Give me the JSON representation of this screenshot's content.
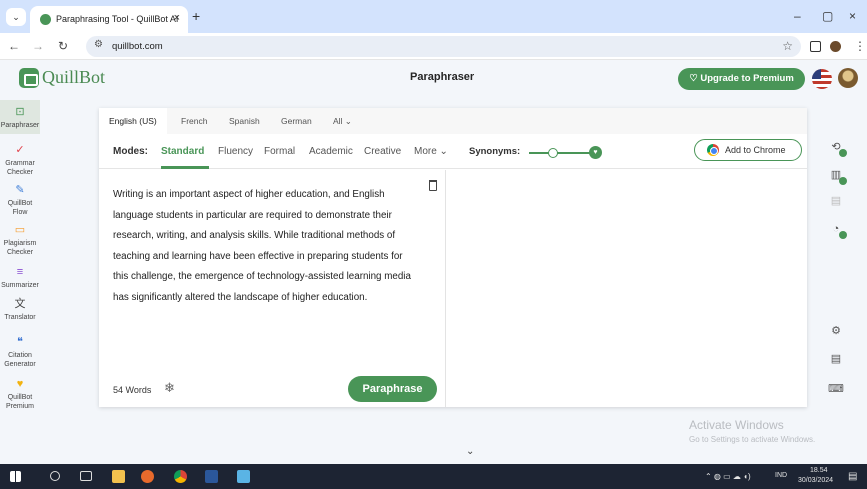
{
  "browser": {
    "tab_title": "Paraphrasing Tool - QuillBot AI",
    "tab_close": "×",
    "new_tab": "+",
    "url": "quillbot.com",
    "controls": {
      "minimize": "–",
      "maximize": "▢",
      "close": "×"
    }
  },
  "header": {
    "logo_text": "QuillBot",
    "page_title": "Paraphraser",
    "upgrade_label": "♡ Upgrade to Premium"
  },
  "sidebar": {
    "items": [
      {
        "label": "Paraphraser",
        "icon": "paraphraser-icon",
        "glyph": "⊡",
        "color": "#499557"
      },
      {
        "label": "Grammar Checker",
        "icon": "grammar-icon",
        "glyph": "✓",
        "color": "#e0424b"
      },
      {
        "label": "QuillBot Flow",
        "icon": "flow-icon",
        "glyph": "✎",
        "color": "#3f7fd8"
      },
      {
        "label": "Plagiarism Checker",
        "icon": "plagiarism-icon",
        "glyph": "▭",
        "color": "#f59b2a"
      },
      {
        "label": "Summarizer",
        "icon": "summarizer-icon",
        "glyph": "≡",
        "color": "#8a4fd1"
      },
      {
        "label": "Translator",
        "icon": "translator-icon",
        "glyph": "文",
        "color": "#444444"
      },
      {
        "label": "Citation Generator",
        "icon": "citation-icon",
        "glyph": "❝",
        "color": "#2f6bcf"
      },
      {
        "label": "QuillBot Premium",
        "icon": "premium-icon",
        "glyph": "♥",
        "color": "#f2b311"
      }
    ]
  },
  "languages": [
    "English (US)",
    "French",
    "Spanish",
    "German",
    "All ⌄"
  ],
  "modes": {
    "label": "Modes:",
    "items": [
      "Standard",
      "Fluency",
      "Formal",
      "Academic",
      "Creative",
      "More ⌄"
    ],
    "active": "Standard"
  },
  "synonyms_label": "Synonyms:",
  "add_to_chrome": "Add to Chrome",
  "editor": {
    "text": "Writing is an important aspect of higher education, and English language students in particular are required to demonstrate their research, writing, and analysis skills. While traditional methods of teaching and learning have been effective in preparing students for this challenge, the emergence of technology-assisted learning media has significantly altered the landscape of higher education.",
    "word_count": "54 Words",
    "paraphrase_label": "Paraphrase"
  },
  "right_rail": [
    "history-icon",
    "compare-icon",
    "statistics-icon",
    "tone-icon",
    "settings-icon",
    "feedback-icon",
    "keyboard-icon"
  ],
  "windows_notice": {
    "title": "Activate Windows",
    "subtitle": "Go to Settings to activate Windows."
  },
  "taskbar": {
    "language": "IND",
    "time": "18.54",
    "date": "30/03/2024"
  },
  "colors": {
    "brand": "#499557",
    "background": "#f3f6fa",
    "taskbar": "#1d2433"
  }
}
